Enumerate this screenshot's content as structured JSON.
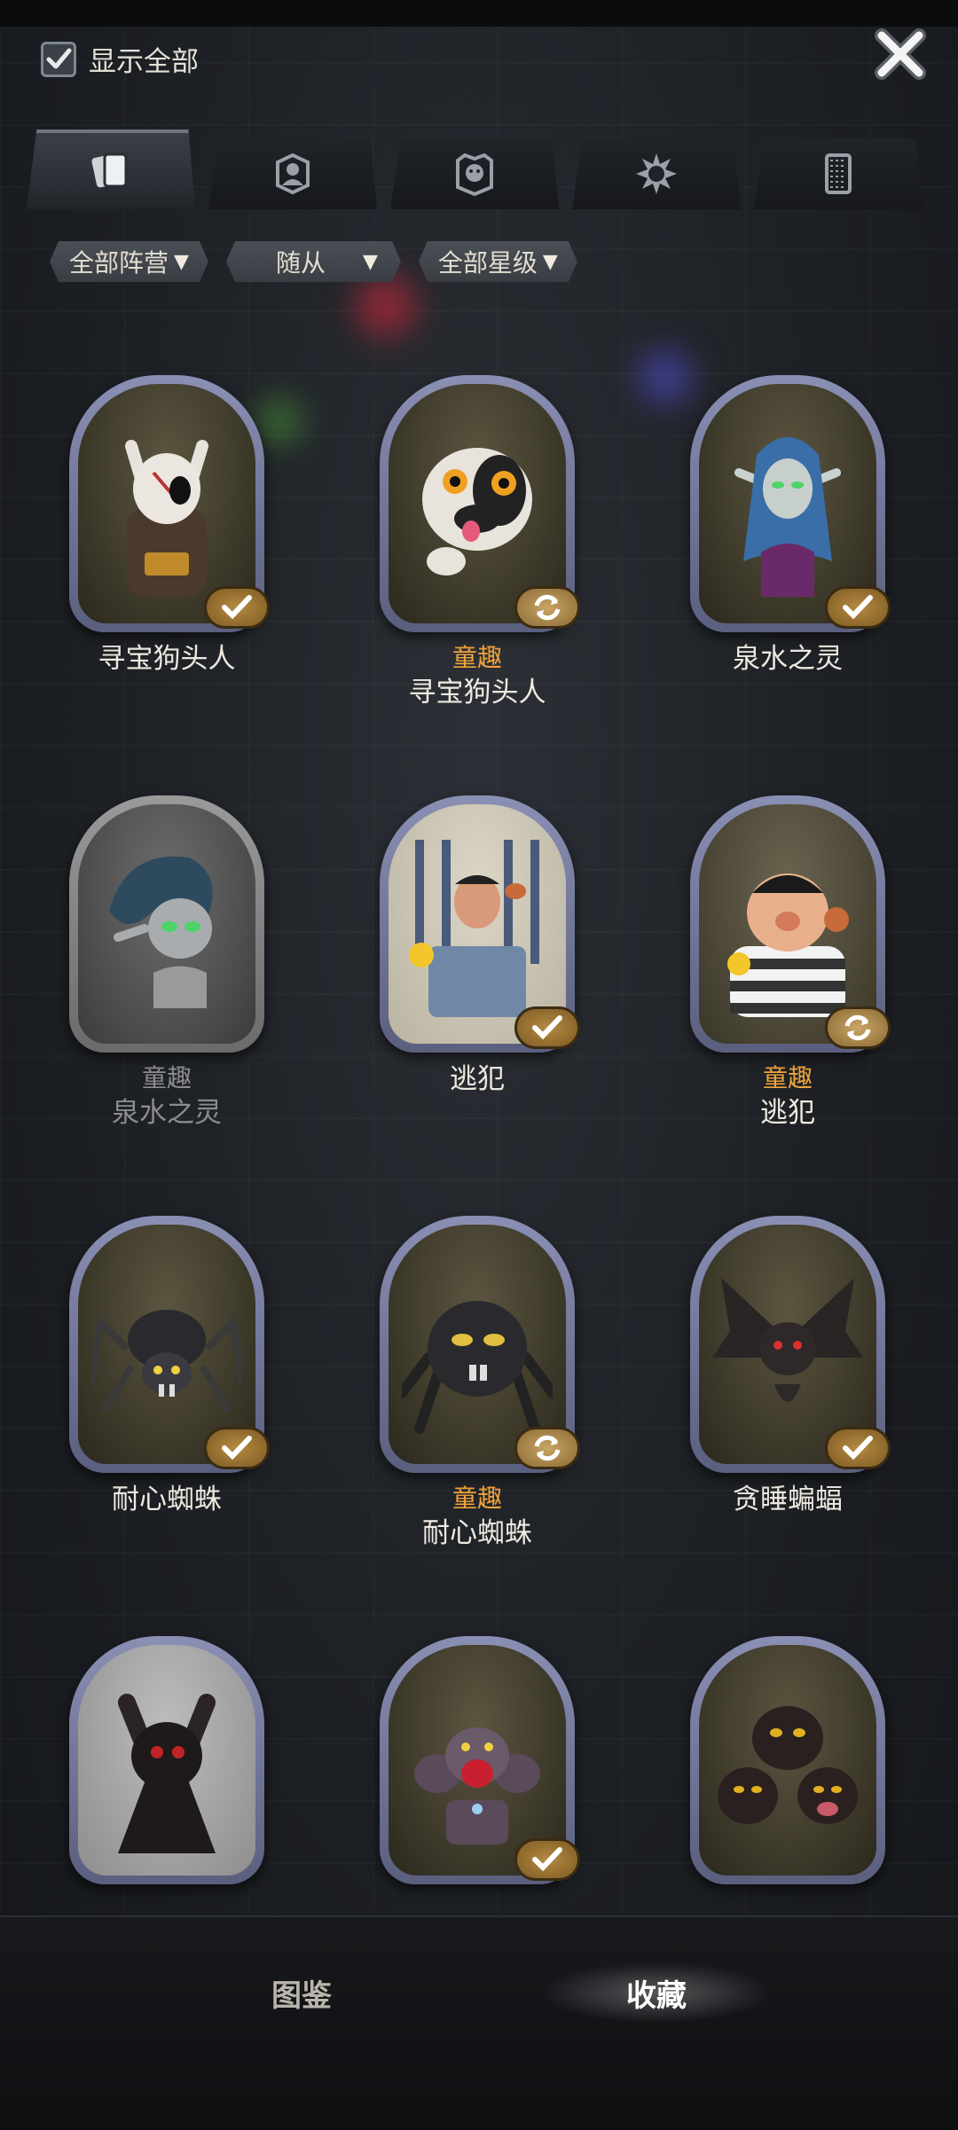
{
  "header": {
    "show_all_label": "显示全部",
    "show_all_checked": true
  },
  "tabs": [
    {
      "icon": "cards-icon",
      "active": true
    },
    {
      "icon": "hero-portrait-icon",
      "active": false
    },
    {
      "icon": "minion-face-icon",
      "active": false
    },
    {
      "icon": "spiky-sun-icon",
      "active": false
    },
    {
      "icon": "card-back-icon",
      "active": false
    }
  ],
  "filters": [
    {
      "label": "全部阵营"
    },
    {
      "label": "随从"
    },
    {
      "label": "全部星级"
    }
  ],
  "cards": [
    {
      "tag": "",
      "name": "寻宝狗头人",
      "badge": "check",
      "dim": false
    },
    {
      "tag": "童趣",
      "name": "寻宝狗头人",
      "badge": "swap",
      "dim": false
    },
    {
      "tag": "",
      "name": "泉水之灵",
      "badge": "check",
      "dim": false
    },
    {
      "tag": "童趣",
      "name": "泉水之灵",
      "badge": "none",
      "dim": true
    },
    {
      "tag": "",
      "name": "逃犯",
      "badge": "check",
      "dim": false
    },
    {
      "tag": "童趣",
      "name": "逃犯",
      "badge": "swap",
      "dim": false
    },
    {
      "tag": "",
      "name": "耐心蜘蛛",
      "badge": "check",
      "dim": false
    },
    {
      "tag": "童趣",
      "name": "耐心蜘蛛",
      "badge": "swap",
      "dim": false
    },
    {
      "tag": "",
      "name": "贪睡蝙蝠",
      "badge": "check",
      "dim": false
    },
    {
      "tag": "",
      "name": "",
      "badge": "none",
      "dim": false
    },
    {
      "tag": "",
      "name": "",
      "badge": "check",
      "dim": false
    },
    {
      "tag": "",
      "name": "",
      "badge": "none",
      "dim": false
    }
  ],
  "bottom_tabs": [
    {
      "label": "图鉴",
      "active": false
    },
    {
      "label": "收藏",
      "active": true
    }
  ],
  "colors": {
    "tag": "#f0a43a",
    "badge": "#b58a42",
    "frame": "#8a8fb4"
  }
}
